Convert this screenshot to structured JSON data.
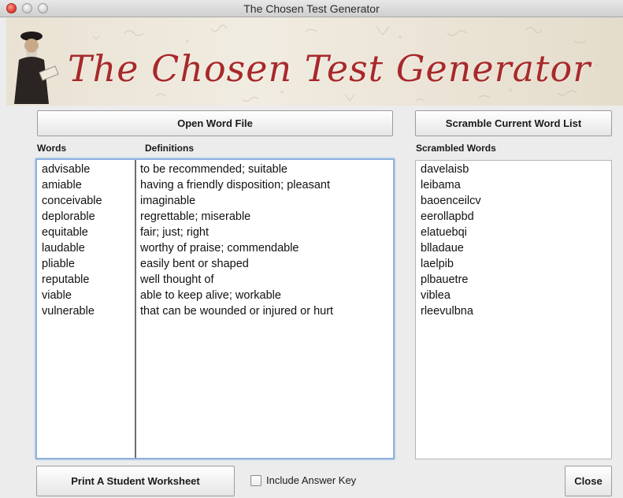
{
  "window": {
    "title": "The Chosen Test Generator"
  },
  "banner": {
    "title": "The Chosen Test Generator"
  },
  "buttons": {
    "open_word_file": "Open Word File",
    "scramble": "Scramble Current Word List",
    "print_worksheet": "Print A Student Worksheet",
    "close": "Close"
  },
  "columns": {
    "words": "Words",
    "definitions": "Definitions",
    "scrambled": "Scrambled Words"
  },
  "entries": [
    {
      "word": "advisable",
      "definition": "to be recommended; suitable",
      "scrambled": "davelaisb"
    },
    {
      "word": "amiable",
      "definition": "having a friendly disposition; pleasant",
      "scrambled": "leibama"
    },
    {
      "word": "conceivable",
      "definition": "imaginable",
      "scrambled": "baoenceilcv"
    },
    {
      "word": "deplorable",
      "definition": "regrettable; miserable",
      "scrambled": "eerollapbd"
    },
    {
      "word": "equitable",
      "definition": "fair; just; right",
      "scrambled": "elatuebqi"
    },
    {
      "word": "laudable",
      "definition": "worthy of praise; commendable",
      "scrambled": "blladaue"
    },
    {
      "word": "pliable",
      "definition": "easily bent or shaped",
      "scrambled": "laelpib"
    },
    {
      "word": "reputable",
      "definition": "well thought of",
      "scrambled": "plbauetre"
    },
    {
      "word": "viable",
      "definition": "able to keep alive; workable",
      "scrambled": "viblea"
    },
    {
      "word": "vulnerable",
      "definition": "that can be wounded or injured or hurt",
      "scrambled": "rleevulbna"
    }
  ],
  "options": {
    "include_answer_key": {
      "label": "Include Answer Key",
      "checked": false
    }
  },
  "colors": {
    "banner_title": "#a8292b",
    "focus_ring": "#8fb2e0"
  }
}
